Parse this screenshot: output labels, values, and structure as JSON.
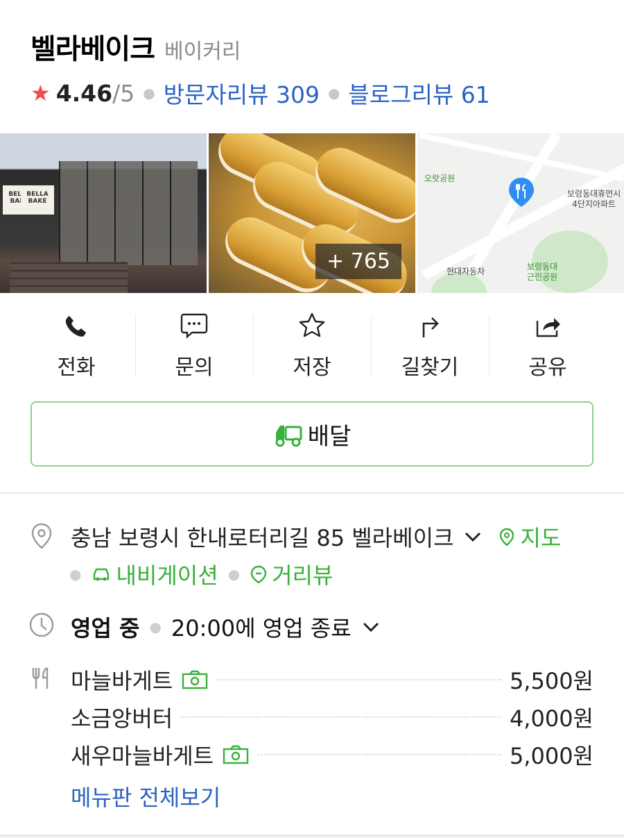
{
  "place": {
    "name": "벨라베이크",
    "category": "베이커리",
    "rating": "4.46",
    "rating_max": "/5",
    "visitor_review": "방문자리뷰 309",
    "blog_review": "블로그리뷰 61"
  },
  "photos": {
    "more_count": "+ 765",
    "store_sign": "BELLA BAKE",
    "store_sign_2": "BELLA BAKE",
    "map_labels": {
      "park1": "오랏공원",
      "apt": "보령동대휴먼시\n4단지아파트",
      "car": "현대자동차",
      "park2": "보령동대\n근린공원"
    }
  },
  "actions": [
    {
      "label": "전화",
      "icon": "phone-icon"
    },
    {
      "label": "문의",
      "icon": "chat-icon"
    },
    {
      "label": "저장",
      "icon": "star-icon"
    },
    {
      "label": "길찾기",
      "icon": "directions-icon"
    },
    {
      "label": "공유",
      "icon": "share-icon"
    }
  ],
  "delivery": {
    "label": "배달",
    "icon": "delivery-truck-icon"
  },
  "address": {
    "text": "충남 보령시 한내로터리길 85 벨라베이크",
    "map_link": "지도",
    "navigation_link": "내비게이션",
    "streetview_link": "거리뷰"
  },
  "hours": {
    "status": "영업 중",
    "detail": "20:00에 영업 종료"
  },
  "menu": {
    "items": [
      {
        "name": "마늘바게트",
        "price": "5,500원",
        "has_photo": true
      },
      {
        "name": "소금앙버터",
        "price": "4,000원",
        "has_photo": false
      },
      {
        "name": "새우마늘바게트",
        "price": "5,000원",
        "has_photo": true
      }
    ],
    "view_all": "메뉴판 전체보기"
  },
  "colors": {
    "accent_blue": "#2a62c4",
    "accent_green": "#38b03a",
    "star_red": "#ef4c4c",
    "map_pin_blue": "#2f8ef3"
  }
}
